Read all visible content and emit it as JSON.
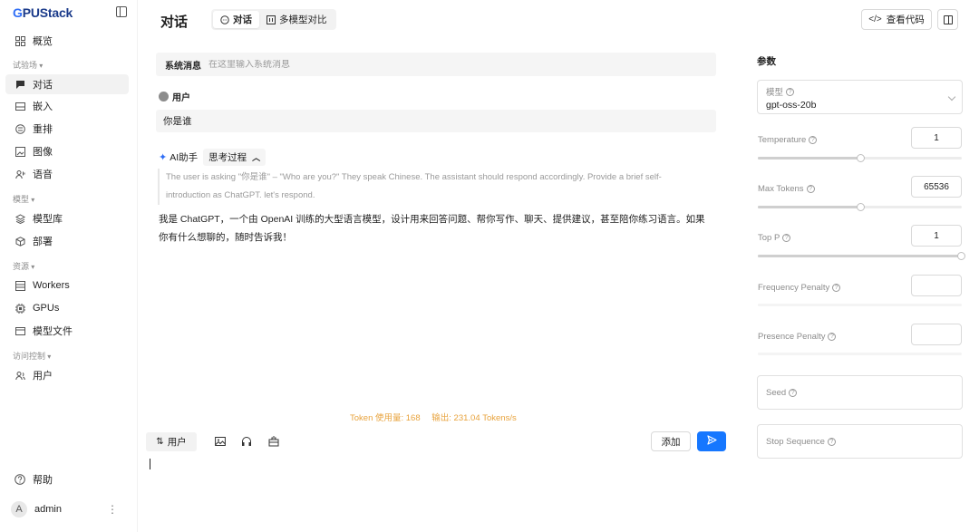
{
  "app": {
    "logo_g": "G",
    "logo_rest": "PUStack"
  },
  "sidebar": {
    "items": [
      {
        "label": "概览",
        "icon": "grid-icon"
      },
      {
        "group": "试验场"
      },
      {
        "label": "对话",
        "icon": "chat-icon",
        "active": true
      },
      {
        "label": "嵌入",
        "icon": "embed-icon"
      },
      {
        "label": "重排",
        "icon": "rerank-icon"
      },
      {
        "label": "图像",
        "icon": "image-icon"
      },
      {
        "label": "语音",
        "icon": "voice-icon"
      },
      {
        "group": "模型"
      },
      {
        "label": "模型库",
        "icon": "layers-icon"
      },
      {
        "label": "部署",
        "icon": "cube-icon"
      },
      {
        "group": "资源"
      },
      {
        "label": "Workers",
        "icon": "list-icon"
      },
      {
        "label": "GPUs",
        "icon": "chip-icon"
      },
      {
        "label": "模型文件",
        "icon": "file-icon"
      },
      {
        "group": "访问控制"
      },
      {
        "label": "用户",
        "icon": "users-icon"
      }
    ],
    "help_label": "帮助",
    "user_initial": "A",
    "user_name": "admin"
  },
  "header": {
    "title": "对话",
    "tabs": [
      {
        "label": "对话",
        "active": true
      },
      {
        "label": "多模型对比",
        "active": false
      }
    ],
    "view_code_label": "查看代码"
  },
  "chat": {
    "system_label": "系统消息",
    "system_placeholder": "在这里输入系统消息",
    "user_role": "用户",
    "user_message": "你是谁",
    "ai_role": "AI助手",
    "thinking_label": "思考过程",
    "thinking_text": "The user is asking \"你是谁\" – \"Who are you?\" They speak Chinese. The assistant should respond accordingly. Provide a brief self-introduction as ChatGPT. let's respond.",
    "answer": "我是 ChatGPT，一个由 OpenAI 训练的大型语言模型，设计用来回答问题、帮你写作、聊天、提供建议，甚至陪你练习语言。如果你有什么想聊的，随时告诉我！",
    "token_usage": "Token 使用量: 168",
    "output_speed": "输出: 231.04 Tokens/s",
    "role_switch_label": "用户",
    "add_label": "添加"
  },
  "params": {
    "title": "参数",
    "model_label": "模型",
    "model_value": "gpt-oss-20b",
    "temperature": {
      "label": "Temperature",
      "value": "1",
      "fraction": 0.5
    },
    "max_tokens": {
      "label": "Max Tokens",
      "value": "65536",
      "fraction": 0.5
    },
    "top_p": {
      "label": "Top P",
      "value": "1",
      "fraction": 1.0
    },
    "frequency_penalty": {
      "label": "Frequency Penalty",
      "value": ""
    },
    "presence_penalty": {
      "label": "Presence Penalty",
      "value": ""
    },
    "seed_label": "Seed",
    "stop_sequence_label": "Stop Sequence"
  },
  "colors": {
    "accent": "#1677ff",
    "brand": "#2f6ef6",
    "token_info": "#e8a33d"
  }
}
